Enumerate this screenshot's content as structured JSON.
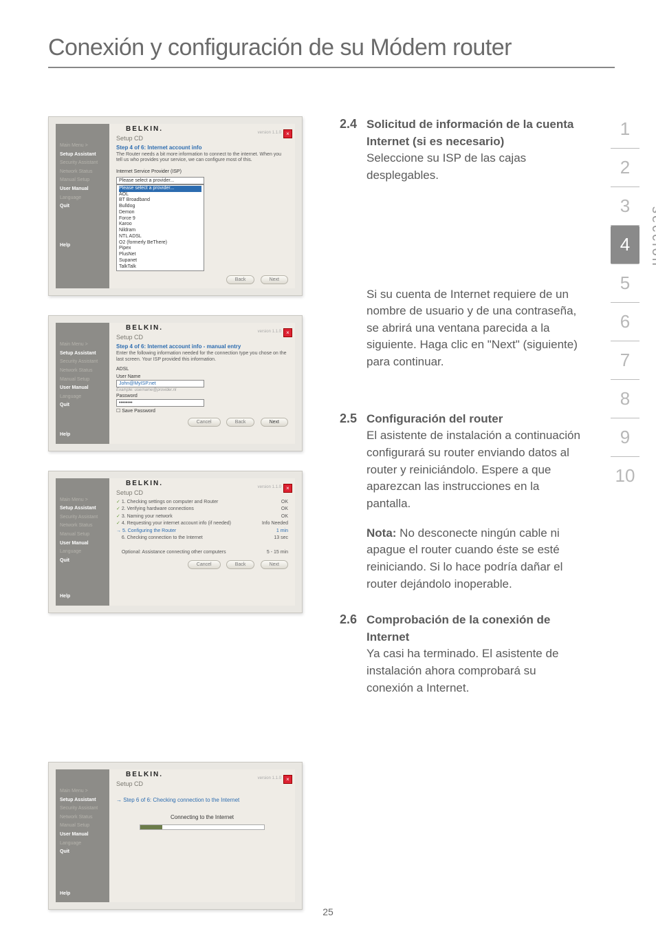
{
  "page_title": "Conexión y configuración de su Módem router",
  "page_number": "25",
  "side": {
    "label": "sección",
    "numbers": [
      "1",
      "2",
      "3",
      "4",
      "5",
      "6",
      "7",
      "8",
      "9",
      "10"
    ],
    "active": "4"
  },
  "sections": {
    "s24": {
      "num": "2.4",
      "head": "Solicitud de información de la cuenta Internet (si es necesario)",
      "body": "Seleccione su ISP de las cajas desplegables."
    },
    "s24b": {
      "body": "Si su cuenta de Internet requiere de un nombre de usuario y de una contraseña, se abrirá una ventana parecida a la siguiente. Haga clic en \"Next\" (siguiente) para continuar."
    },
    "s25": {
      "num": "2.5",
      "head": "Configuración del router",
      "body": "El asistente de instalación a continuación configurará su router enviando datos al router y reiniciándolo. Espere a que aparezcan las instrucciones en la pantalla.",
      "note_label": "Nota:",
      "note": " No desconecte ningún cable ni apague el router cuando éste se esté reiniciando. Si lo hace podría dañar el router dejándolo inoperable."
    },
    "s26": {
      "num": "2.6",
      "head": "Comprobación de la conexión de Internet",
      "body": "Ya casi ha terminado. El asistente de instalación ahora comprobará su conexión a Internet."
    }
  },
  "shot_common": {
    "brand": "BELKIN.",
    "setup": "Setup CD",
    "version": "version 1.1.0",
    "sidebar": {
      "main_menu": "Main Menu  >",
      "setup_assistant": "Setup Assistant",
      "security_assistant": "Security Assistant",
      "network_status": "Network Status",
      "manual_setup": "Manual Setup",
      "user_manual": "User Manual",
      "language": "Language",
      "quit": "Quit",
      "help": "Help"
    },
    "buttons": {
      "back": "Back",
      "next": "Next",
      "cancel": "Cancel"
    }
  },
  "shot1": {
    "step": "Step 4 of 6: Internet account info",
    "desc": "The Router needs a bit more information to connect to the internet. When you tell us who provides your service, we can configure most of this.",
    "isp_label": "Internet Service Provider (ISP)",
    "select_placeholder": "Please select a provider...",
    "options": [
      "Please select a provider...",
      "AOL",
      "BT Broadband",
      "Bulldog",
      "Demon",
      "Force 9",
      "Karoo",
      "Nildram",
      "NTL ADSL",
      "O2 (formerly BeThere)",
      "Pipex",
      "PlusNet",
      "Supanet",
      "TalkTalk"
    ]
  },
  "shot2": {
    "step": "Step 4 of 6: Internet account info - manual entry",
    "desc": "Enter the following information needed for the connection type you chose on the last screen. Your ISP provided this information.",
    "adsl": "ADSL",
    "user_label": "User Name",
    "user_value": "John@MyISP.net",
    "user_hint": "Example: username@provider.nl",
    "pass_label": "Password",
    "pass_value": "••••••••",
    "save_pw": "Save Password"
  },
  "shot3": {
    "rows": [
      {
        "t": "1. Checking settings on computer and Router",
        "s": "OK"
      },
      {
        "t": "2. Verifying hardware connections",
        "s": "OK"
      },
      {
        "t": "3. Naming your network",
        "s": "OK"
      },
      {
        "t": "4. Requesting your internet account info (if needed)",
        "s": "Info Needed"
      },
      {
        "t": "5. Configuring the Router",
        "s": "1 min"
      },
      {
        "t": "6. Checking connection to the Internet",
        "s": "13 sec"
      }
    ],
    "optional": "Optional: Assistance connecting other computers",
    "optional_s": "5 - 15 min"
  },
  "shot4": {
    "step": "Step 6 of 6: Checking connection to the Internet",
    "connecting": "Connecting to the Internet"
  }
}
